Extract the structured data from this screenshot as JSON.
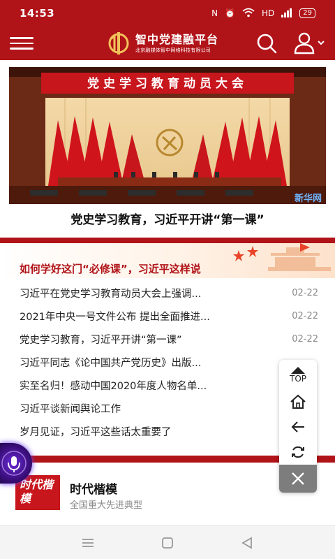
{
  "status": {
    "time": "14:53",
    "network": "HD",
    "battery": "29"
  },
  "header": {
    "title": "智中党建融平台",
    "subtitle": "北京融媒体智中网络科技有限公司"
  },
  "hero": {
    "banner_text": "党史学习教育动员大会",
    "watermark": "新华网",
    "caption": "党史学习教育，习近平开讲“第一课”"
  },
  "section": {
    "title": "如何学好这门“必修课”，习近平这样说",
    "items": [
      {
        "title": "习近平在党史学习教育动员大会上强调...",
        "date": "02-22"
      },
      {
        "title": "2021年中央一号文件公布 提出全面推进...",
        "date": "02-22"
      },
      {
        "title": "党史学习教育，习近平开讲“第一课”",
        "date": "02-22"
      },
      {
        "title": "习近平同志《论中国共产党历史》出版...",
        "date": ""
      },
      {
        "title": "实至名归！感动中国2020年度人物名单...",
        "date": ""
      },
      {
        "title": "习近平谈新闻舆论工作",
        "date": ""
      },
      {
        "title": "岁月见证，习近平这些话太重要了",
        "date": ""
      }
    ]
  },
  "card": {
    "badge": "时代楷模",
    "title": "时代楷模",
    "subtitle": "全国重大先进典型"
  },
  "float_bar": {
    "top_label": "TOP"
  },
  "colors": {
    "brand_red": "#b01318",
    "accent_red": "#c8161d"
  }
}
